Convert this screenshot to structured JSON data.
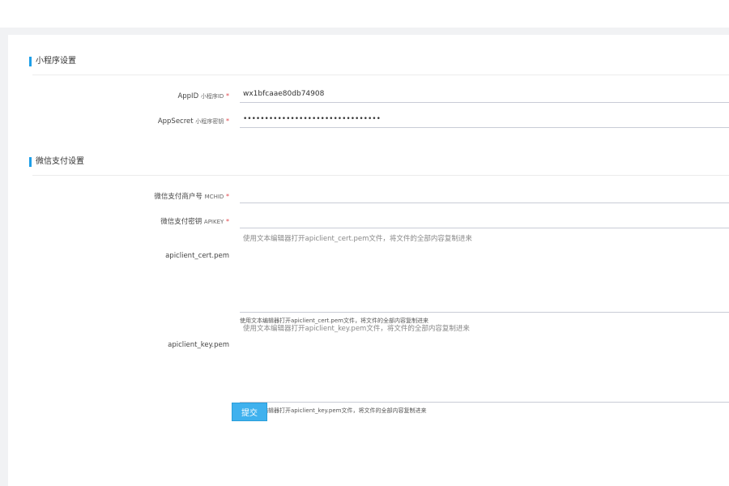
{
  "sections": {
    "miniprogram": {
      "title": "小程序设置",
      "appid": {
        "label": "AppID",
        "sub": "小程序ID",
        "required": "*",
        "value": "wx1bfcaae80db74908"
      },
      "appsecret": {
        "label": "AppSecret",
        "sub": "小程序密钥",
        "required": "*",
        "value": "••••••••••••••••••••••••••••••••"
      }
    },
    "wxpay": {
      "title": "微信支付设置",
      "mchid": {
        "label": "微信支付商户号",
        "sub": "MCHID",
        "required": "*",
        "value": ""
      },
      "apikey": {
        "label": "微信支付密钥",
        "sub": "APIKEY",
        "required": "*",
        "value": ""
      },
      "cert": {
        "label": "apiclient_cert.pem",
        "placeholder": "使用文本编辑器打开apiclient_cert.pem文件，将文件的全部内容复制进来",
        "hint": "使用文本编辑器打开apiclient_cert.pem文件，将文件的全部内容复制进来"
      },
      "key": {
        "label": "apiclient_key.pem",
        "placeholder": "使用文本编辑器打开apiclient_key.pem文件，将文件的全部内容复制进来",
        "hint": "使用文本编辑器打开apiclient_key.pem文件，将文件的全部内容复制进来"
      }
    }
  },
  "submit_label": "提交",
  "colors": {
    "accent": "#1e9fe8",
    "button": "#3fb1ee",
    "required": "#e0454a"
  }
}
